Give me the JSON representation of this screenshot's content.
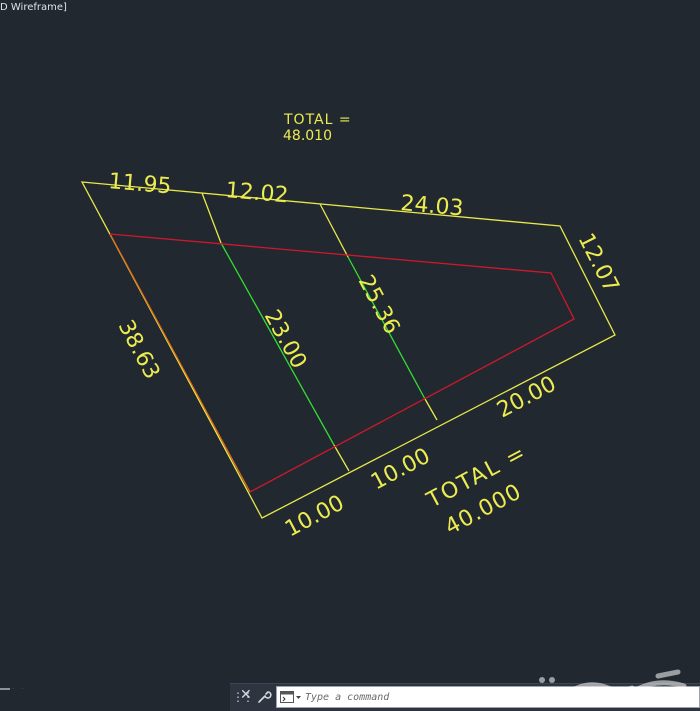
{
  "viewport": {
    "label": "D Wireframe]"
  },
  "annotations": {
    "top_total_label": "TOTAL =",
    "top_total_value": "48.010",
    "bottom_total_label": "TOTAL =",
    "bottom_total_value": "40.000"
  },
  "dimensions": {
    "top_left": "11.95",
    "top_mid": "12.02",
    "top_right": "24.03",
    "right_side": "12.07",
    "left_side": "38.63",
    "divider_left": "23.00",
    "divider_right": "25.36",
    "bottom_left": "10.00",
    "bottom_mid": "10.00",
    "bottom_right": "20.00"
  },
  "command_line": {
    "placeholder": "Type a command"
  },
  "colors": {
    "background": "#212830",
    "boundary": "#e8e84a",
    "dividers": "#33dd33",
    "red_outline": "#d0182a",
    "orange_edge": "#e06a18",
    "text": "#ecec50"
  },
  "icons": {
    "ucs": "ucs-icon",
    "close": "close-icon",
    "wrench": "customize-wrench-icon",
    "prompt": "command-prompt-icon",
    "watermark": "watermark-logo"
  }
}
